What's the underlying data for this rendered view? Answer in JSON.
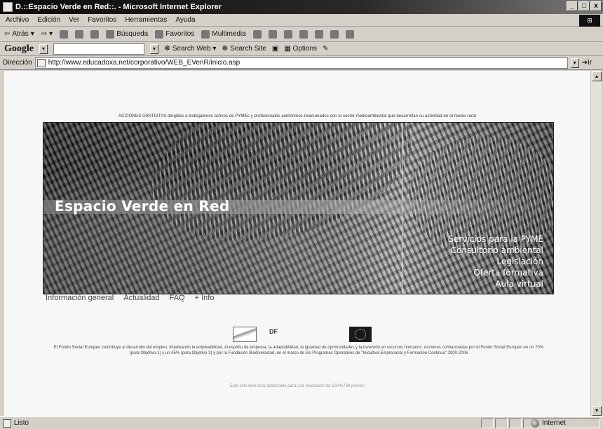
{
  "window": {
    "title": "D.::Espacio Verde en Red::. - Microsoft Internet Explorer",
    "buttons": [
      "_",
      "□",
      "x"
    ]
  },
  "menu": [
    "Archivo",
    "Edición",
    "Ver",
    "Favoritos",
    "Herramientas",
    "Ayuda"
  ],
  "toolbar": {
    "back": "Atrás",
    "search": "Búsqueda",
    "favorites": "Favoritos",
    "multimedia": "Multimedia"
  },
  "google_bar": {
    "logo": "Google",
    "search_web": "Search Web",
    "search_site": "Search Site",
    "options": "Options"
  },
  "address": {
    "label": "Dirección",
    "url": "http://www.educadoxa.net/corporativo/WEB_EVenR/inicio.asp",
    "go": "Ir"
  },
  "page": {
    "top_note": "ACCIONES GRATUITAS dirigidas a trabajadores activos de PYMEs y profesionales autónomos relacionados con el sector medioambiental que desarrollan su actividad en el medio rural",
    "banner_title": "Espacio Verde en Red",
    "side_menu": [
      "Servicios para la PYME",
      "Consultorio ambiental",
      "Legislación",
      "Oferta formativa",
      "Aula virtual"
    ],
    "bottom_nav": [
      "Información general",
      "Actualidad",
      "FAQ",
      "+ Info"
    ],
    "logo_b_text": "DF",
    "fse_text": "El Fondo Social Europeo contribuye al desarrollo del empleo, impulsando la empleabilidad, el espíritu de empresa, la adaptabilidad, la igualdad de oportunidades y la inversión en recursos humanos. Acciones cofinanciadas por el Fondo Social Europeo en un 70% (para Objetivo 1) y un 45% (para Objetivo 3) y por la Fundación Biodiversidad, en el marco de los Programas Operativos de \"Iniciativa Empresarial y Formación Continua\" 2000-2006",
    "optimized_text": "Este sitio web está optimizado para una resolución de 1024x768 píxeles"
  },
  "status": {
    "text": "Listo",
    "zone": "Internet"
  }
}
